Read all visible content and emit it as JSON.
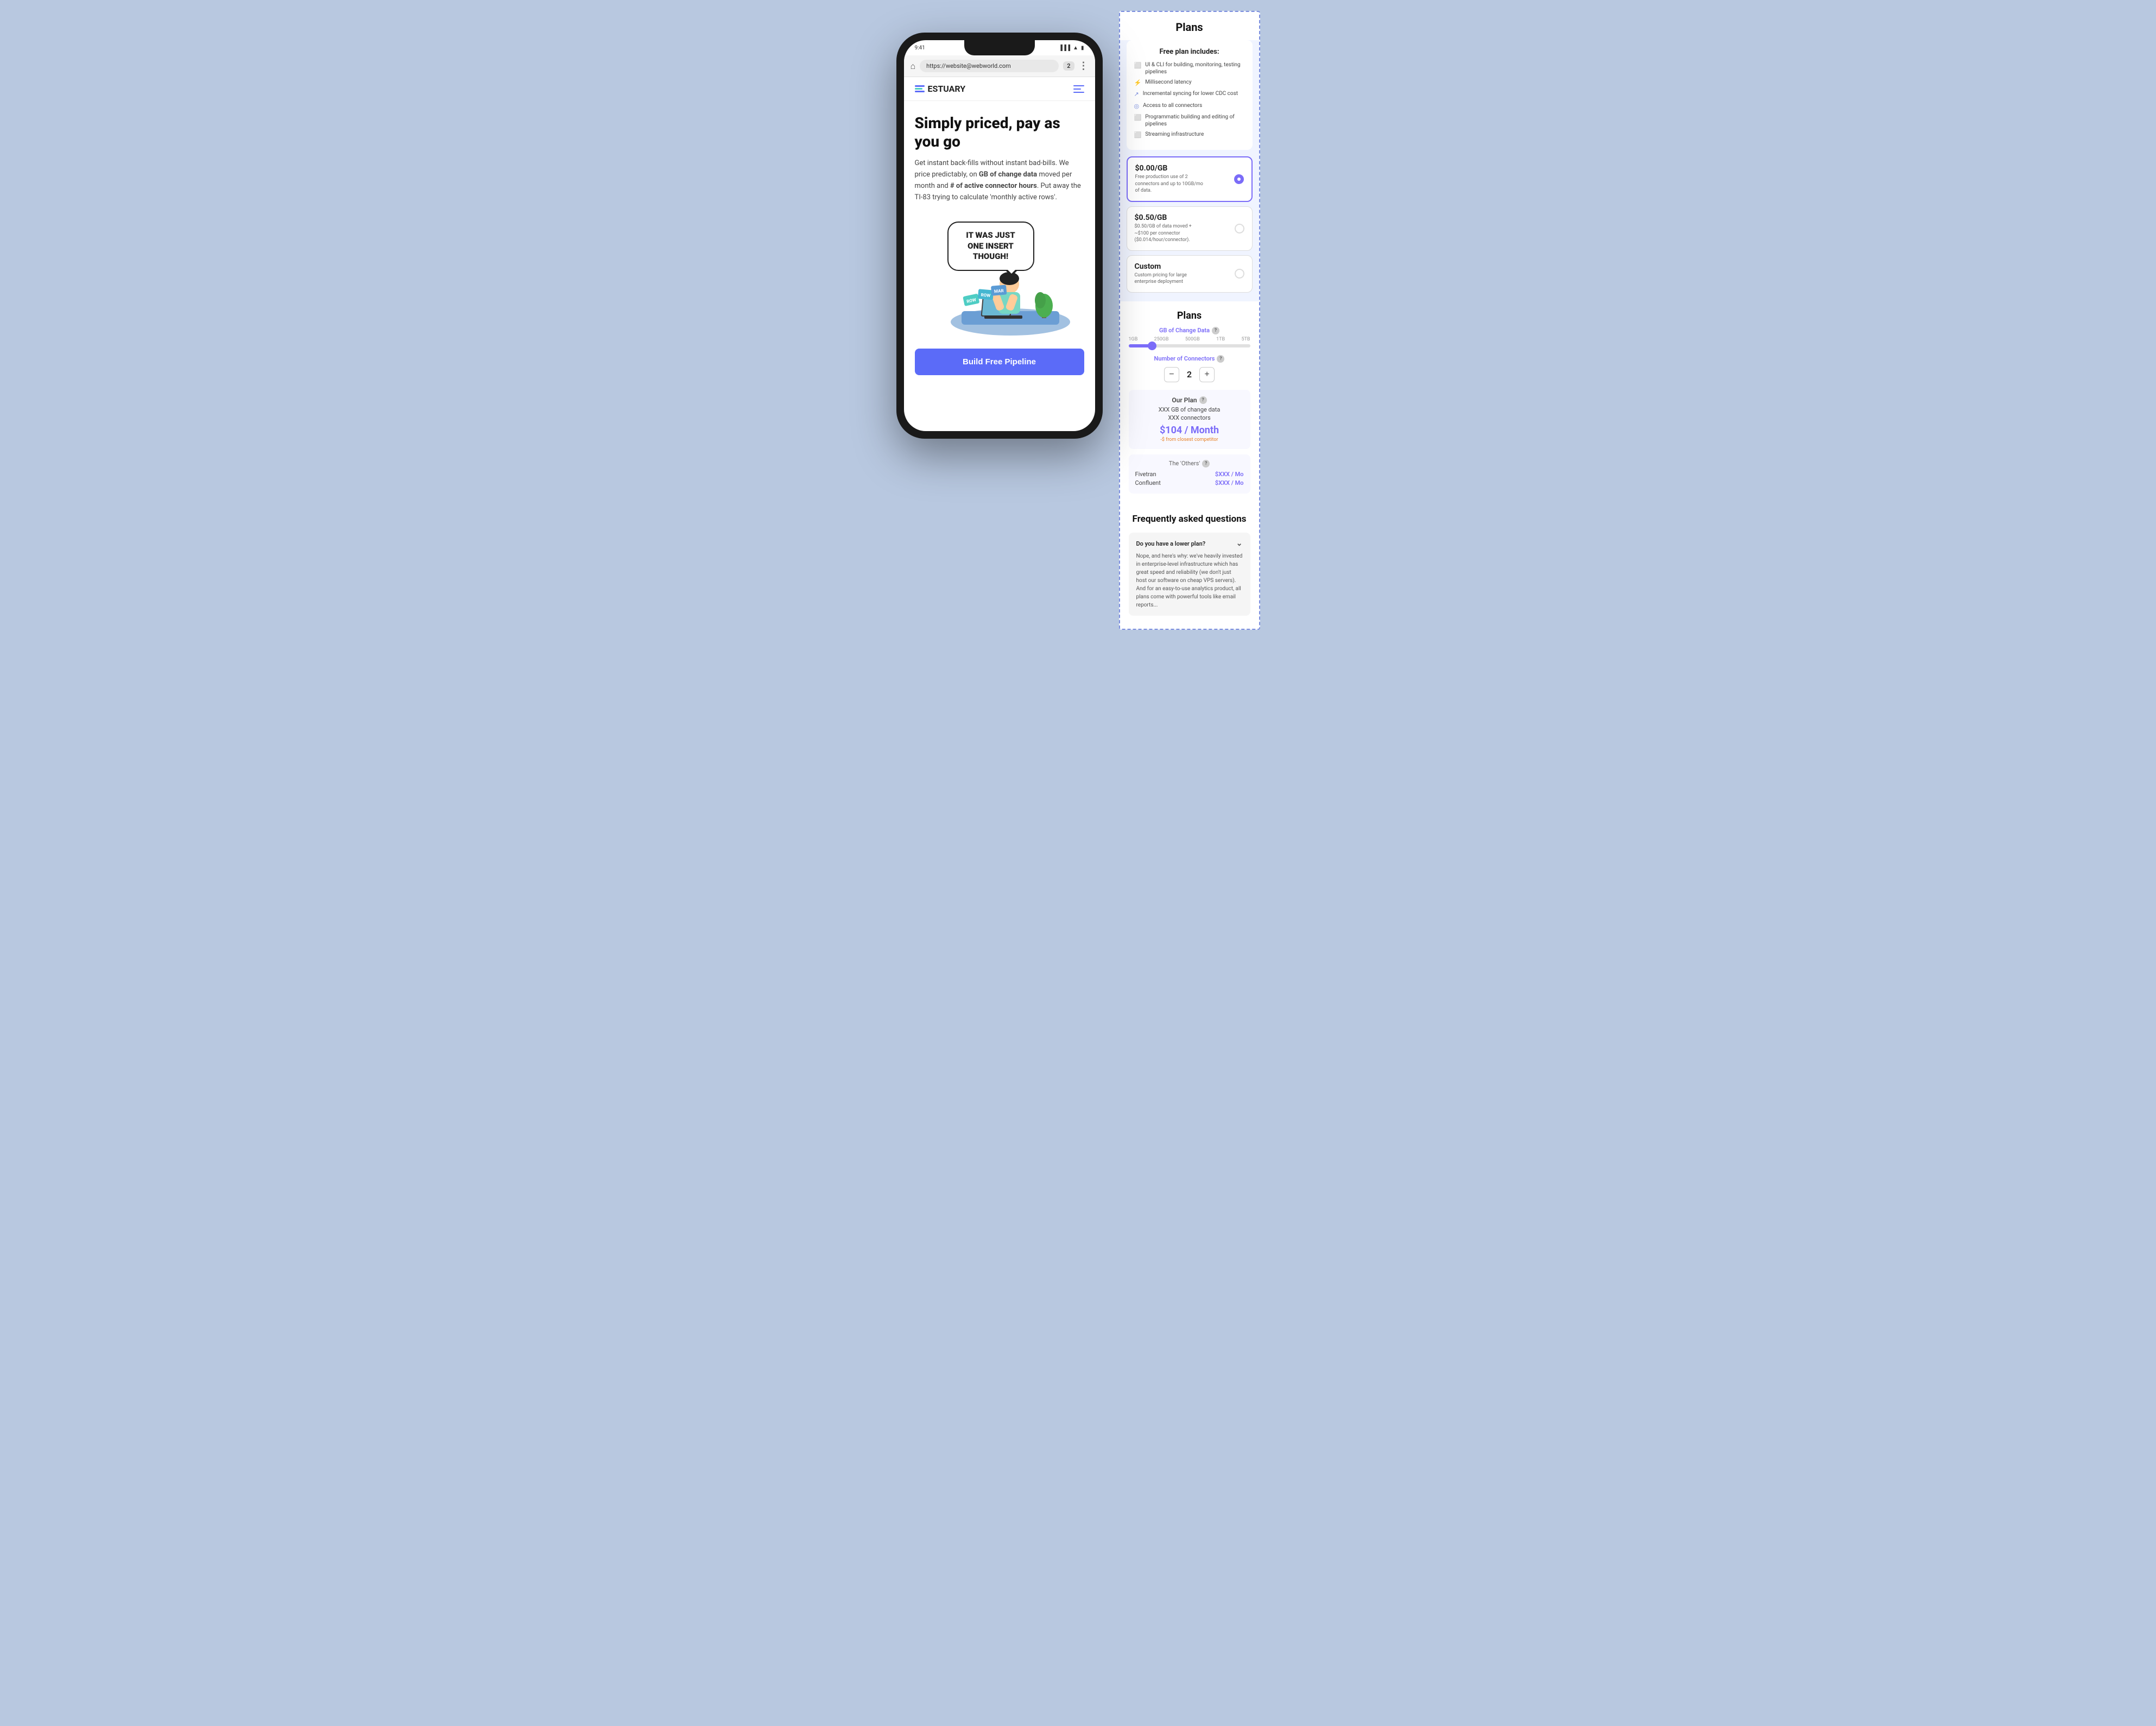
{
  "browser": {
    "url": "https://website@webworld.com",
    "tabs": "2"
  },
  "site": {
    "logo": "ESTUARY",
    "hero_title": "Simply priced, pay as you go",
    "hero_description": "Get instant back-fills without instant bad-bills. We price predictably, on GB of change data moved per month and # of active connector hours. Put away the TI-83 trying to calculate 'monthly active rows'.",
    "speech_bubble": "IT WAS JUST ONE INSERT THOUGH!",
    "row_cards": [
      "ROW",
      "ROW",
      "MAR"
    ],
    "cta_button": "Build Free Pipeline"
  },
  "right_panel": {
    "plans_title": "Plans",
    "free_plan": {
      "title": "Free plan includes:",
      "items": [
        "UI & CLI for building, monitoring, testing pipelines",
        "Millisecond latency",
        "Incremental syncing for lower CDC cost",
        "Access to all connectors",
        "Programmatic building and editing of pipelines",
        "Streaming infrastructure"
      ]
    },
    "pricing_options": [
      {
        "price": "$0.00/GB",
        "description": "Free production use of 2 connectors and up to 10GB/mo of data.",
        "selected": true
      },
      {
        "price": "$0.50/GB",
        "description": "$0.50/GB of data moved + ~$100 per connector ($0.014/hour/connector).",
        "selected": false
      },
      {
        "price": "Custom",
        "description": "Custom pricing for large enterprise deployment",
        "selected": false
      }
    ],
    "calculator": {
      "title": "Plans",
      "gb_label": "GB of Change Data",
      "slider_labels": [
        "1GB",
        "250GB",
        "500GB",
        "1TB",
        "5TB"
      ],
      "connectors_label": "Number of Connectors",
      "connectors_value": "2",
      "our_plan": {
        "title": "Our Plan",
        "gb_data": "XXX GB of change data",
        "connectors": "XXX connectors",
        "price": "$104 / Month",
        "savings": "-$ from closest competitor"
      },
      "others": {
        "title": "The 'Others'",
        "competitors": [
          {
            "name": "Fivetran",
            "price": "$XXX / Mo"
          },
          {
            "name": "Confluent",
            "price": "$XXX / Mo"
          }
        ]
      }
    },
    "faq": {
      "title": "Frequently asked questions",
      "items": [
        {
          "question": "Do you have a lower plan?",
          "answer": "Nope, and here's why: we've heavily invested in enterprise-level infrastructure which has great speed and reliability (we don't just host our software on cheap VPS servers). And for an easy-to-use analytics product, all plans come with powerful tools like email reports...",
          "open": true
        }
      ]
    }
  }
}
